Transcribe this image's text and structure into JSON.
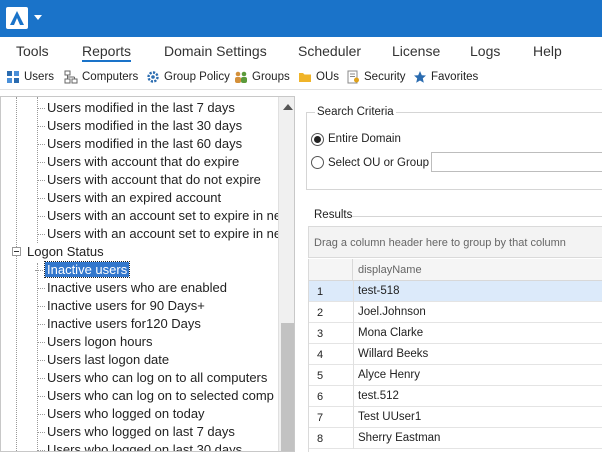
{
  "menu": [
    "Tools",
    "Reports",
    "Domain Settings",
    "Scheduler",
    "License",
    "Logs",
    "Help"
  ],
  "active_menu": "Reports",
  "toolbar": [
    {
      "label": "Users",
      "icon": "users-icon"
    },
    {
      "label": "Computers",
      "icon": "computers-icon"
    },
    {
      "label": "Group Policy",
      "icon": "group-policy-icon"
    },
    {
      "label": "Groups",
      "icon": "groups-icon"
    },
    {
      "label": "OUs",
      "icon": "folder-icon"
    },
    {
      "label": "Security",
      "icon": "security-icon"
    },
    {
      "label": "Favorites",
      "icon": "star-icon"
    }
  ],
  "tree": {
    "items_top": [
      "Users modified in the last 7 days",
      "Users modified in the last 30 days",
      "Users modified in the last 60 days",
      "Users with account  that do expire",
      "Users with account that do not expire",
      "Users with an expired account",
      "Users with an account set to expire in ne",
      "Users with an account set to expire in ne"
    ],
    "group_label": "Logon Status",
    "items_bottom": [
      "Inactive users",
      "Inactive users who are enabled",
      "Inactive users for 90 Days+",
      "Inactive users for120 Days",
      "Users logon hours",
      "Users last logon date",
      "Users who can log on to all computers",
      "Users who can log on to selected comp",
      "Users who logged on today",
      "Users who logged on last 7 days",
      "Users who logged on last 30 days"
    ],
    "selected": "Inactive users"
  },
  "search": {
    "title": "Search Criteria",
    "option_domain": "Entire Domain",
    "option_ou": "Select OU or Group",
    "selected": "Entire Domain",
    "ou_value": ""
  },
  "results": {
    "title": "Results",
    "group_hint": "Drag a column header here to group by that column",
    "column": "displayName",
    "rows": [
      {
        "num": "1",
        "name": "test-518"
      },
      {
        "num": "2",
        "name": "Joel.Johnson"
      },
      {
        "num": "3",
        "name": "Mona Clarke"
      },
      {
        "num": "4",
        "name": "Willard Beeks"
      },
      {
        "num": "5",
        "name": "Alyce Henry"
      },
      {
        "num": "6",
        "name": "test.512"
      },
      {
        "num": "7",
        "name": "Test UUser1"
      },
      {
        "num": "8",
        "name": "Sherry Eastman"
      }
    ],
    "selected_row": "1"
  },
  "colors": {
    "accent": "#1a73c9",
    "selection": "#3377cc",
    "row_selected": "#dceafa"
  }
}
